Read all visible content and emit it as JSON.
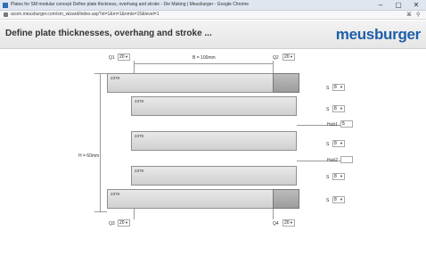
{
  "browser": {
    "window_title": "Plates for SM modular concept Define plate thickness, overhang and stroke - Die Making | Meusburger - Google Chrome",
    "url": "acom.meusburger.com/sm_wizard/index.asp?st=1&m=1&nmts=15&level=1",
    "controls": [
      "–",
      "▢",
      "✕"
    ]
  },
  "header": {
    "title": "Define plate thicknesses, overhang and stroke ...",
    "logo": "meusburger"
  },
  "top": {
    "q1_label": "Q1",
    "q1_value": "20",
    "b_label": "B = 100mm",
    "q2_label": "Q2",
    "q2_value": "20"
  },
  "bottom": {
    "q3_label": "Q3",
    "q3_value": "20",
    "q4_label": "Q4",
    "q4_value": "20"
  },
  "left_dimension": "H = 60mm",
  "plates": [
    {
      "name": "2379",
      "s_label": "S",
      "s_value": "8"
    },
    {
      "name": "2379",
      "s_label": "S",
      "s_value": "8"
    },
    {
      "name": "2379",
      "s_label": "S",
      "s_value": "8"
    },
    {
      "name": "2379",
      "s_label": "S",
      "s_value": "8"
    },
    {
      "name": "2379",
      "s_label": "S",
      "s_value": "8"
    }
  ],
  "hub1": {
    "label": "Hub1",
    "value": "5"
  },
  "hub2": {
    "label": "Hub2",
    "value": ""
  }
}
